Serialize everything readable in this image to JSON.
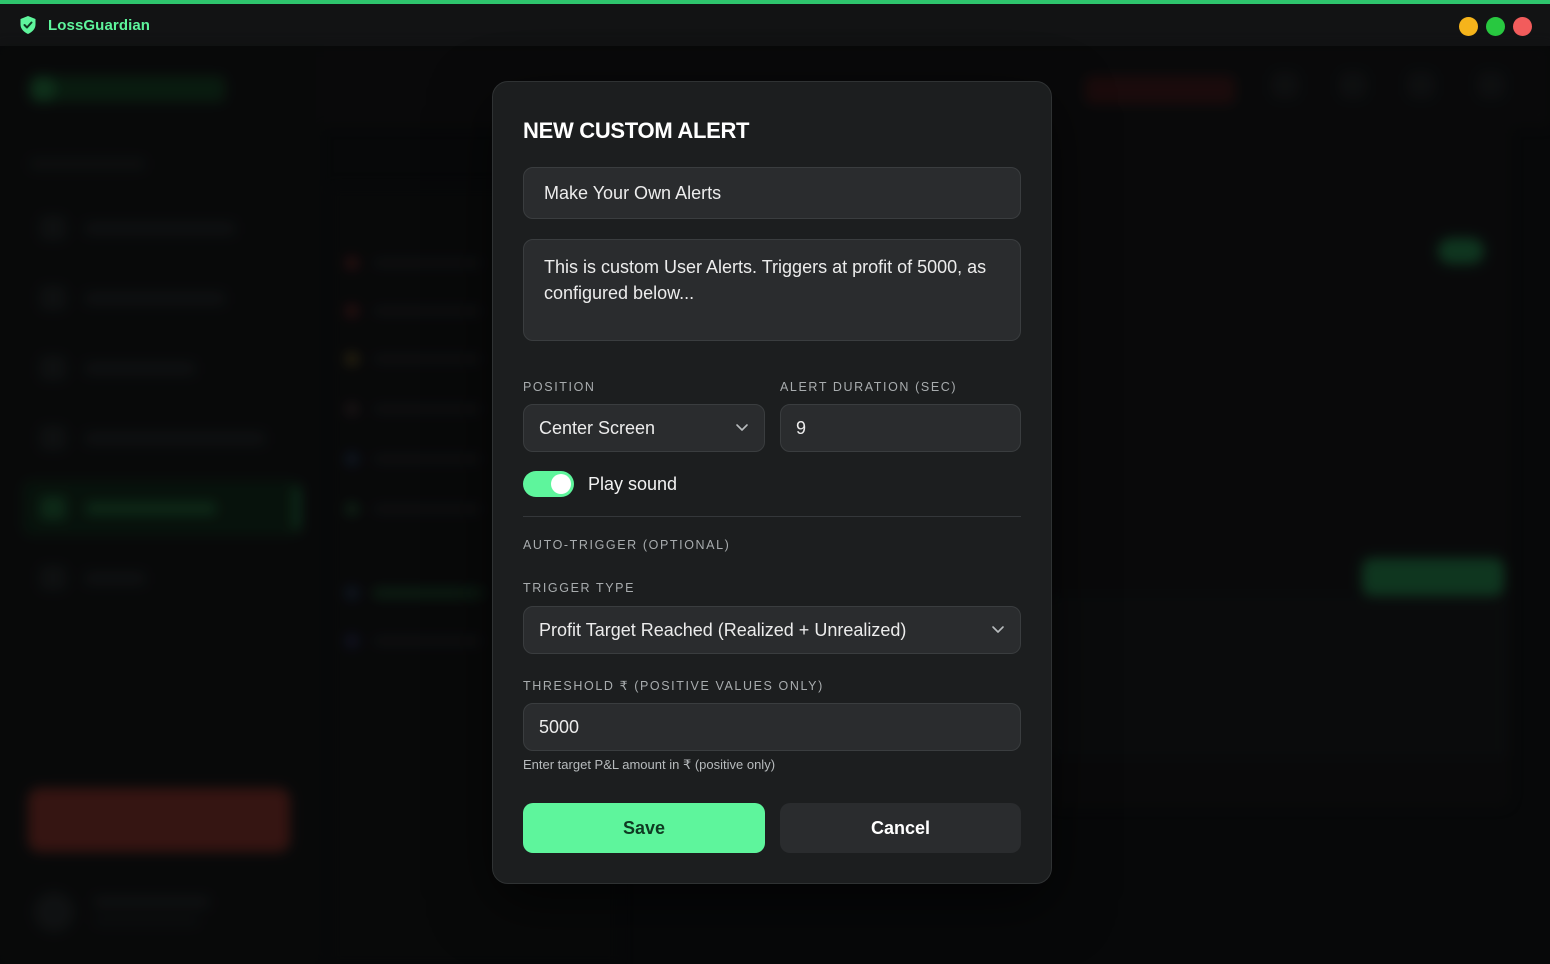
{
  "app": {
    "name": "LossGuardian"
  },
  "modal": {
    "title": "NEW CUSTOM ALERT",
    "name_value": "Make Your Own Alerts",
    "description_value": "This is custom User Alerts. Triggers at profit of 5000, as configured below...",
    "position": {
      "label": "POSITION",
      "value": "Center Screen"
    },
    "duration": {
      "label": "ALERT DURATION (SEC)",
      "value": "9"
    },
    "play_sound": {
      "label": "Play sound",
      "enabled": true
    },
    "auto_trigger_label": "AUTO-TRIGGER (OPTIONAL)",
    "trigger_type": {
      "label": "TRIGGER TYPE",
      "value": "Profit Target Reached (Realized + Unrealized)"
    },
    "threshold": {
      "label": "THRESHOLD ₹ (POSITIVE VALUES ONLY)",
      "value": "5000",
      "hint": "Enter target P&L amount in ₹ (positive only)"
    },
    "save_label": "Save",
    "cancel_label": "Cancel"
  },
  "colors": {
    "accent": "#5ef59c",
    "modal_bg": "#1c1e1f",
    "field_bg": "#2a2c2e"
  }
}
